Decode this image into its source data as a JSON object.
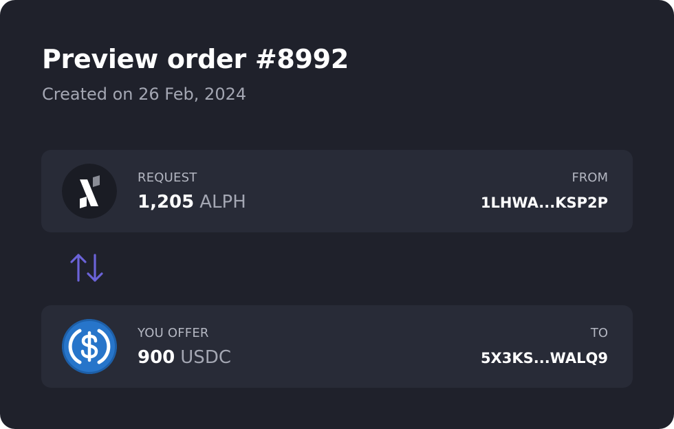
{
  "order": {
    "title": "Preview order #8992",
    "created": "Created on 26 Feb, 2024"
  },
  "request": {
    "label": "REQUEST",
    "amount": "1,205",
    "symbol": "ALPH",
    "icon": "alph-token-icon",
    "address_label": "FROM",
    "address": "1LHWA...KSP2P"
  },
  "swap": {
    "icon": "swap-arrows-icon",
    "color": "#6b63d8"
  },
  "offer": {
    "label": "YOU OFFER",
    "amount": "900",
    "symbol": "USDC",
    "icon": "usdc-token-icon",
    "address_label": "TO",
    "address": "5X3KS...WALQ9"
  },
  "colors": {
    "background": "#1f212b",
    "panel": "#282b37",
    "usdc_blue": "#2775ca",
    "alph_circle": "#1a1c24"
  }
}
